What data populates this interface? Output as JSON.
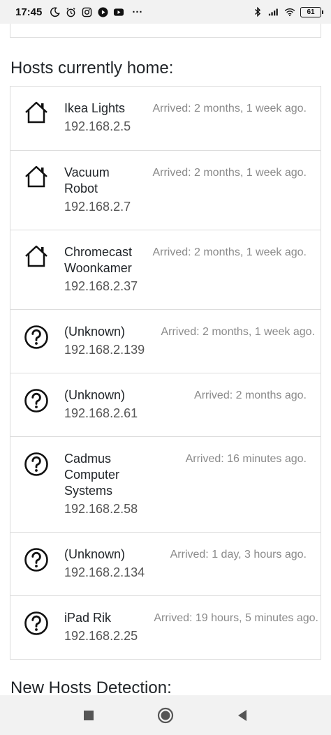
{
  "status_bar": {
    "time": "17:45",
    "battery": "61",
    "icons": [
      "moon-icon",
      "alarm-icon",
      "instagram-icon",
      "play-icon",
      "youtube-icon",
      "more-dots-icon",
      "bluetooth-icon",
      "signal-icon",
      "wifi-icon",
      "battery-icon"
    ],
    "more": "···"
  },
  "hosts_heading": "Hosts currently home:",
  "new_hosts_heading": "New Hosts Detection:",
  "hosts": [
    {
      "icon": "house-icon",
      "name": "Ikea Lights",
      "ip": "192.168.2.5",
      "arrived": "Arrived: 2 months, 1 week ago."
    },
    {
      "icon": "house-icon",
      "name": "Vacuum Robot",
      "ip": "192.168.2.7",
      "arrived": "Arrived: 2 months, 1 week ago."
    },
    {
      "icon": "house-icon",
      "name": "Chromecast Woonkamer",
      "ip": "192.168.2.37",
      "arrived": "Arrived: 2 months, 1 week ago."
    },
    {
      "icon": "question-circle-icon",
      "name": "(Unknown)",
      "ip": "192.168.2.139",
      "arrived": "Arrived: 2 months, 1 week ago."
    },
    {
      "icon": "question-circle-icon",
      "name": "(Unknown)",
      "ip": "192.168.2.61",
      "arrived": "Arrived: 2 months ago."
    },
    {
      "icon": "question-circle-icon",
      "name": "Cadmus Computer Systems",
      "ip": "192.168.2.58",
      "arrived": "Arrived: 16 minutes ago."
    },
    {
      "icon": "question-circle-icon",
      "name": "(Unknown)",
      "ip": "192.168.2.134",
      "arrived": "Arrived: 1 day, 3 hours ago."
    },
    {
      "icon": "question-circle-icon",
      "name": "iPad Rik",
      "ip": "192.168.2.25",
      "arrived": "Arrived: 19 hours, 5 minutes ago."
    }
  ],
  "nav_bar": [
    "recents-square-icon",
    "home-circle-icon",
    "back-triangle-icon"
  ]
}
